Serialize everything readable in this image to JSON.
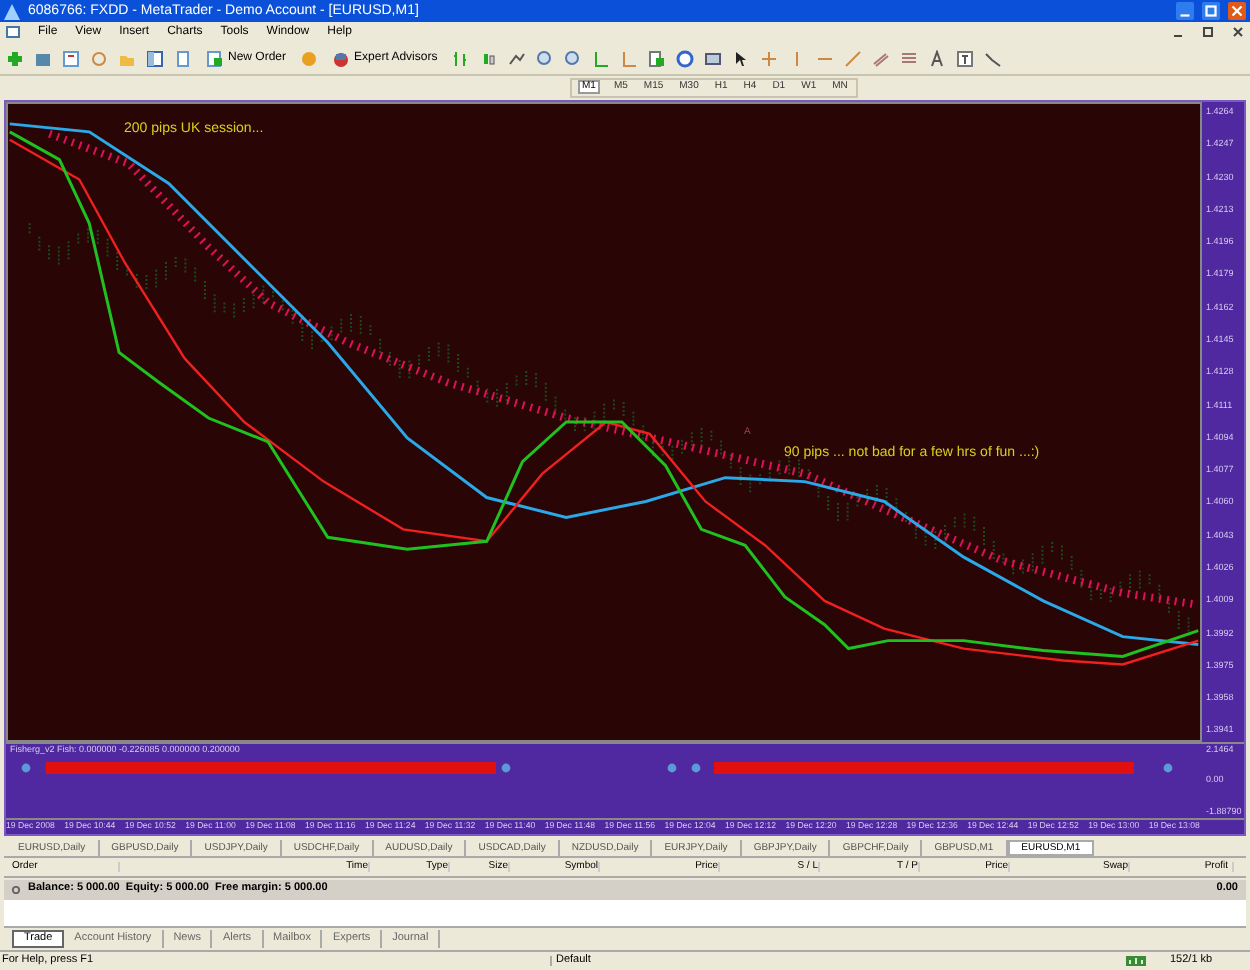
{
  "window": {
    "title": "6086766: FXDD - MetaTrader - Demo Account - [EURUSD,M1]"
  },
  "menu": [
    "File",
    "View",
    "Insert",
    "Charts",
    "Tools",
    "Window",
    "Help"
  ],
  "toolbar": {
    "buttons": [
      "New Order",
      "Expert Advisors"
    ]
  },
  "timeframes": [
    {
      "label": "M1",
      "selected": true
    },
    {
      "label": "M5",
      "selected": false
    },
    {
      "label": "M15",
      "selected": false
    },
    {
      "label": "M30",
      "selected": false
    },
    {
      "label": "H1",
      "selected": false
    },
    {
      "label": "H4",
      "selected": false
    },
    {
      "label": "D1",
      "selected": false
    },
    {
      "label": "W1",
      "selected": false
    },
    {
      "label": "MN",
      "selected": false
    }
  ],
  "chart": {
    "annotations": [
      "200 pips UK session...",
      "90 pips ... not bad for a few hrs of fun ...:)",
      "A"
    ],
    "price_axis": [
      "1.4264",
      "1.4247",
      "1.4230",
      "1.4213",
      "1.4196",
      "1.4179",
      "1.4162",
      "1.4145",
      "1.4128",
      "1.4111",
      "1.4094",
      "1.4077",
      "1.4060",
      "1.4043",
      "1.4026",
      "1.4009",
      "1.3992",
      "1.3975",
      "1.3958",
      "1.3941"
    ],
    "indicator": {
      "label": "Fisherg_v2 Fish: 0.000000 -0.226085 0.000000 0.200000",
      "axis": [
        "2.1464",
        "0.00",
        "-1.88790"
      ]
    },
    "time_axis": [
      "19 Dec 2008",
      "19 Dec 10:44",
      "19 Dec 10:52",
      "19 Dec 11:00",
      "19 Dec 11:08",
      "19 Dec 11:16",
      "19 Dec 11:24",
      "19 Dec 11:32",
      "19 Dec 11:40",
      "19 Dec 11:48",
      "19 Dec 11:56",
      "19 Dec 12:04",
      "19 Dec 12:12",
      "19 Dec 12:20",
      "19 Dec 12:28",
      "19 Dec 12:36",
      "19 Dec 12:44",
      "19 Dec 12:52",
      "19 Dec 13:00",
      "19 Dec 13:08"
    ]
  },
  "chart_tabs": [
    {
      "label": "EURUSD,Daily",
      "selected": false
    },
    {
      "label": "GBPUSD,Daily",
      "selected": false
    },
    {
      "label": "USDJPY,Daily",
      "selected": false
    },
    {
      "label": "USDCHF,Daily",
      "selected": false
    },
    {
      "label": "AUDUSD,Daily",
      "selected": false
    },
    {
      "label": "USDCAD,Daily",
      "selected": false
    },
    {
      "label": "NZDUSD,Daily",
      "selected": false
    },
    {
      "label": "EURJPY,Daily",
      "selected": false
    },
    {
      "label": "GBPJPY,Daily",
      "selected": false
    },
    {
      "label": "GBPCHF,Daily",
      "selected": false
    },
    {
      "label": "GBPUSD,M1",
      "selected": false
    },
    {
      "label": "EURUSD,M1",
      "selected": true
    }
  ],
  "terminal": {
    "columns": [
      "Order",
      "Time",
      "Type",
      "Size",
      "Symbol",
      "Price",
      "S / L",
      "T / P",
      "Price",
      "Swap",
      "Profit"
    ],
    "balance": "Balance: 5 000.00  Equity: 5 000.00  Free margin: 5 000.00",
    "profit": "0.00",
    "tabs": [
      {
        "label": "Trade",
        "selected": true
      },
      {
        "label": "Account History",
        "selected": false
      },
      {
        "label": "News",
        "selected": false
      },
      {
        "label": "Alerts",
        "selected": false
      },
      {
        "label": "Mailbox",
        "selected": false
      },
      {
        "label": "Experts",
        "selected": false
      },
      {
        "label": "Journal",
        "selected": false
      }
    ]
  },
  "status_bar": {
    "help": "For Help, press F1",
    "profile": "Default",
    "traffic": "152/1 kb"
  }
}
